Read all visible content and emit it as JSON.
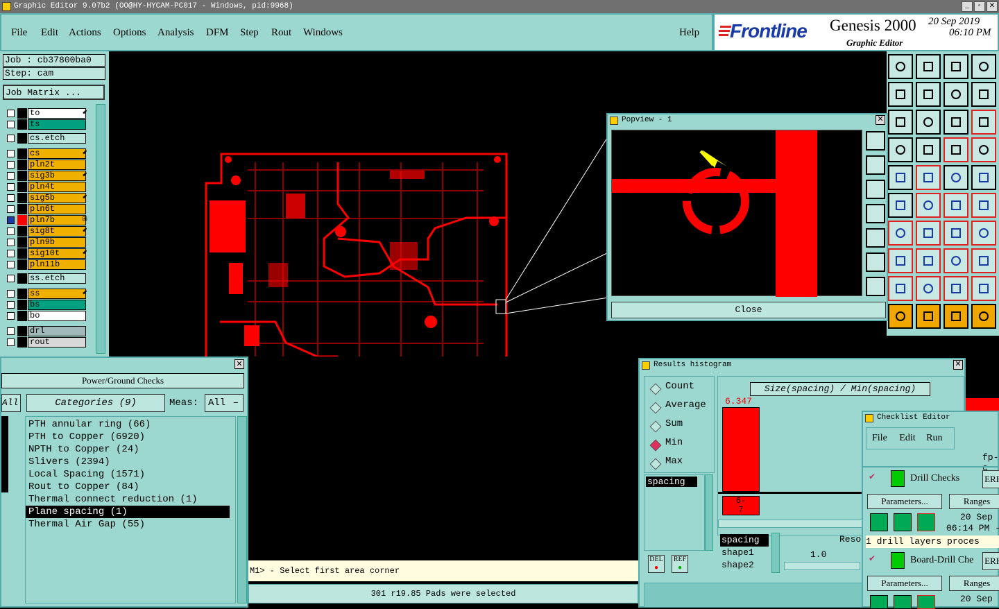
{
  "window": {
    "title": "Graphic Editor 9.07b2 (OO@HY-HYCAM-PC017 - Windows, pid:9968)"
  },
  "menu": {
    "items": [
      "File",
      "Edit",
      "Actions",
      "Options",
      "Analysis",
      "DFM",
      "Step",
      "Rout",
      "Windows"
    ],
    "help": "Help"
  },
  "brand": {
    "logo": "Frontline",
    "product": "Genesis 2000",
    "subtitle": "Graphic Editor",
    "date": "20 Sep 2019",
    "time": "06:10 PM"
  },
  "job": {
    "job": "Job : cb37800ba0",
    "step": "Step: cam",
    "matrix_button": "Job Matrix ..."
  },
  "layers": [
    {
      "name": "to",
      "color": "#ffffff",
      "mark": "⬋"
    },
    {
      "name": "ts",
      "color": "#00a080",
      "mark": ""
    },
    {
      "name": "cs.etch",
      "color": "#bde6df",
      "mark": ""
    },
    {
      "name": "cs",
      "color": "#f0b000",
      "mark": "⬋"
    },
    {
      "name": "pln2t",
      "color": "#f0b000",
      "mark": ""
    },
    {
      "name": "sig3b",
      "color": "#f0b000",
      "mark": "⬋"
    },
    {
      "name": "pln4t",
      "color": "#f0b000",
      "mark": ""
    },
    {
      "name": "sig5b",
      "color": "#f0b000",
      "mark": "⬋"
    },
    {
      "name": "pln6t",
      "color": "#f0b000",
      "mark": ""
    },
    {
      "name": "pln7b",
      "color": "#f0b000",
      "mark": "⊞"
    },
    {
      "name": "sig8t",
      "color": "#f0b000",
      "mark": "⬋"
    },
    {
      "name": "pln9b",
      "color": "#f0b000",
      "mark": ""
    },
    {
      "name": "sig10t",
      "color": "#f0b000",
      "mark": "⬋"
    },
    {
      "name": "pln11b",
      "color": "#f0b000",
      "mark": ""
    },
    {
      "name": "ss.etch",
      "color": "#bde6df",
      "mark": ""
    },
    {
      "name": "ss",
      "color": "#f0b000",
      "mark": "⬋"
    },
    {
      "name": "bs",
      "color": "#00a080",
      "mark": ""
    },
    {
      "name": "bo",
      "color": "#ffffff",
      "mark": ""
    },
    {
      "name": "drl",
      "color": "#a0b8b8",
      "mark": ""
    },
    {
      "name": "rout",
      "color": "#d8d8d8",
      "mark": ""
    }
  ],
  "popview": {
    "title": "Popview - 1",
    "close_label": "Close"
  },
  "power_ground": {
    "title": "Power/Ground Checks",
    "all_label": "All",
    "categories_label": "Categories (9)",
    "meas_label": "Meas:",
    "meas_value": "All",
    "categories": [
      "PTH annular ring (66)",
      "PTH to Copper (6920)",
      "NPTH to Copper (24)",
      "Slivers (2394)",
      "Local Spacing (1571)",
      "Rout to Copper (84)",
      "Thermal connect reduction (1)",
      "Plane spacing (1)",
      "Thermal Air Gap (55)"
    ],
    "selected_index": 7
  },
  "status": {
    "prompt": "M1> - Select first area corner",
    "message": "301 r19.85 Pads were selected"
  },
  "histogram": {
    "title": "Results histogram",
    "options": [
      "Count",
      "Average",
      "Sum",
      "Min",
      "Max"
    ],
    "selected_option": "Min",
    "list": [
      "spacing"
    ],
    "plot_title": "Size(spacing) / Min(spacing)",
    "bar_value": "6.347",
    "bar_range": "6-7",
    "bar_range_top": "6-",
    "bar_range_bottom": "7",
    "fields": [
      "spacing",
      "shape1",
      "shape2"
    ],
    "reso_label": "Reso",
    "reso_value": "1.0",
    "del_label": "DEL",
    "ref_label": "REF"
  },
  "checklist": {
    "title": "Checklist Editor",
    "menu": [
      "File",
      "Edit",
      "Run"
    ],
    "name_fragment": "fp-c",
    "items": [
      {
        "name": "Drill Checks",
        "erf": "ERF",
        "date": "20 Sep",
        "time": "06:14 PM -",
        "summary": "1 drill layers proces"
      },
      {
        "name": "Board-Drill Che",
        "erf": "ERF",
        "date": "20 Sep",
        "time": "",
        "summary": ""
      }
    ],
    "parameters_label": "Parameters...",
    "ranges_label": "Ranges"
  },
  "toolbar_icons": [
    "layer-up-icon",
    "layer-down-icon",
    "home-icon",
    "split-view-icon",
    "layer-in-icon",
    "layer-out-icon",
    "mirror-icon",
    "snake-icon",
    "fit-icon",
    "pan-icon",
    "scale-1-2-icon",
    "help-icon",
    "grid-snap-icon",
    "grid-icon",
    "board-icon",
    "board-check-icon",
    "select-icon",
    "draw-line-icon",
    "ruler-icon",
    "circle-icon",
    "connect-icon",
    "intersect-icon",
    "add-node-icon",
    "node-icon",
    "measure-angle-icon",
    "line-icon",
    "arc-icon",
    "align-icon",
    "square-node-icon",
    "break-icon",
    "dimension-icon",
    "cluster-icon",
    "triangle-icon",
    "arch-icon",
    "arch2-icon",
    "arch3-icon",
    "pointer-icon",
    "pointer-box-icon",
    "pointer-alt-icon",
    "pointer-node-icon"
  ],
  "popview_tools": [
    "zoom-in-icon",
    "layer-up-icon",
    "layer-down-icon",
    "layer-in-icon",
    "layer-out-icon",
    "fit-icon",
    "pan-icon"
  ],
  "colors": {
    "panel": "#9cd8d0",
    "copper": "#ff0000",
    "highlight": "#f0b000",
    "arrow": "#ffff00"
  }
}
